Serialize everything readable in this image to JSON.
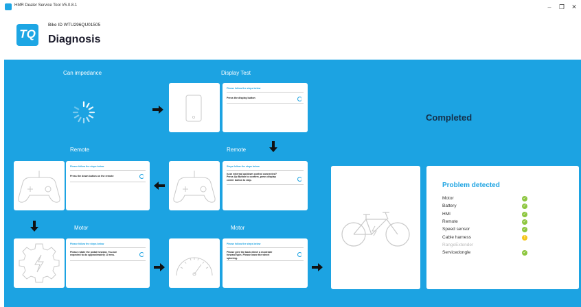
{
  "window": {
    "title": "HMR Dealer Service Tool V5.0.8.1",
    "minimize": "–",
    "restore": "❐",
    "close": "✕"
  },
  "header": {
    "logo_text": "TQ",
    "bike_id": "Bike ID  WTU296QU01505",
    "title": "Diagnosis"
  },
  "steps": {
    "can_impedance": "Can impedance",
    "display_test": "Display Test",
    "remote_left": "Remote",
    "remote_right": "Remote",
    "motor_left": "Motor",
    "motor_right": "Motor"
  },
  "panels": {
    "display": {
      "head": "Please follow the steps below",
      "text": "Press the display button"
    },
    "remote_right": {
      "head": "Steps follow the steps below",
      "text": "Is an external up/down control connected? Press Up Button to confirm, press display center button to skip."
    },
    "remote_left": {
      "head": "Please follow the steps below",
      "text": "Press the down button on the remote"
    },
    "motor_left": {
      "head": "Please follow the steps below",
      "text": "Please rotate the pedal forward. You are expected to do approximately 10 revs."
    },
    "motor_right": {
      "head": "Please follow the steps below",
      "text": "Please give the back wheel a moderate forward spin. Please leave the wheel spinning."
    }
  },
  "status": {
    "completed": "Completed"
  },
  "problem": {
    "title": "Problem detected",
    "items": [
      {
        "label": "Motor",
        "state": "ok"
      },
      {
        "label": "Battery",
        "state": "ok"
      },
      {
        "label": "HMI",
        "state": "ok"
      },
      {
        "label": "Remote",
        "state": "ok"
      },
      {
        "label": "Speed sensor",
        "state": "ok"
      },
      {
        "label": "Cable harness",
        "state": "warn"
      },
      {
        "label": "RangeExtender",
        "state": "disabled"
      },
      {
        "label": "Servicedongle",
        "state": "ok"
      }
    ],
    "ok_symbol": "✓",
    "warn_symbol": "!",
    "colors": {
      "ok": "#8dc63f",
      "warn": "#f5c518",
      "accent": "#1ca3e2"
    }
  }
}
